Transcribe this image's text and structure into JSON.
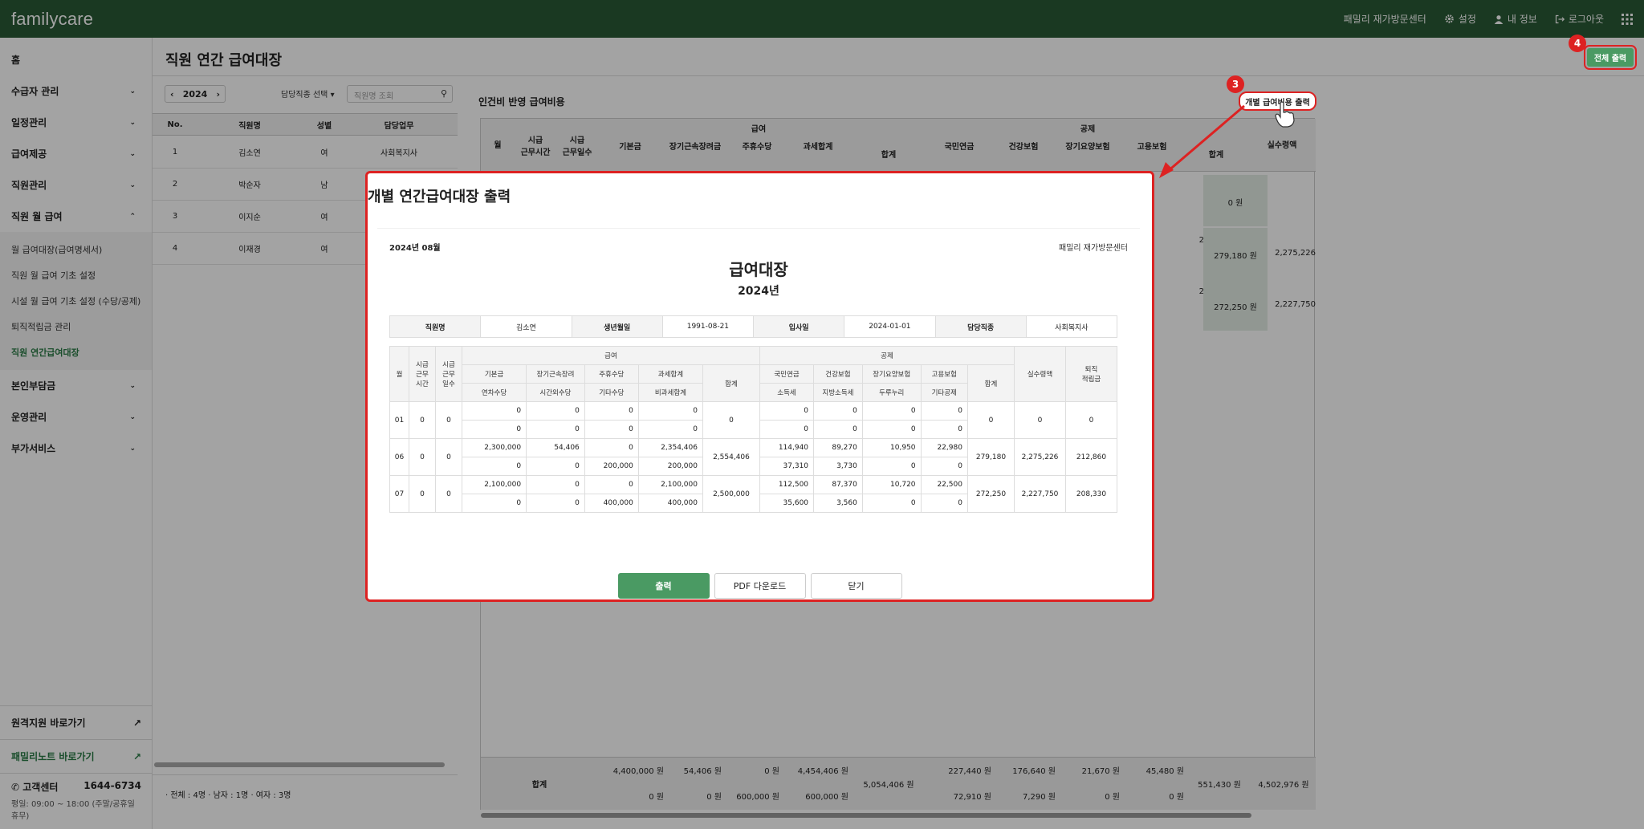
{
  "app": {
    "logo": "familycare"
  },
  "topbar": {
    "center_name": "패밀리 재가방문센터",
    "settings": "설정",
    "myinfo": "내 정보",
    "logout": "로그아웃"
  },
  "sidebar": {
    "home": "홈",
    "items": [
      "수급자 관리",
      "일정관리",
      "급여제공",
      "직원관리",
      "직원 월 급여"
    ],
    "subitems": [
      "월 급여대장(급여명세서)",
      "직원 월 급여 기초 설정",
      "시설 월 급여 기초 설정 (수당/공제)",
      "퇴직적립금 관리",
      "직원 연간급여대장"
    ],
    "items2": [
      "본인부담금",
      "운영관리",
      "부가서비스"
    ],
    "remote": "원격지원 바로가기",
    "note": "패밀리노트 바로가기",
    "cs_label": "고객센터",
    "cs_phone": "1644-6734",
    "cs_hours": "평일: 09:00 ~ 18:00 (주말/공휴일 휴무)"
  },
  "page": {
    "title": "직원 연간 급여대장",
    "print_all": "전체 출력"
  },
  "left": {
    "year": "2024",
    "role_select": "담당직종 선택",
    "search_placeholder": "직원명 조회",
    "headers": [
      "No.",
      "직원명",
      "성별",
      "담당업무"
    ],
    "rows": [
      [
        "1",
        "김소연",
        "여",
        "사회복지사"
      ],
      [
        "2",
        "박순자",
        "남",
        ""
      ],
      [
        "3",
        "이지순",
        "여",
        ""
      ],
      [
        "4",
        "이재경",
        "여",
        ""
      ]
    ],
    "count": "· 전체 : 4명  · 남자 : 1명  · 여자 : 3명"
  },
  "right": {
    "title": "인건비 반영 급여비용",
    "indiv_print": "개별 급여비용 출력",
    "head": {
      "month": "월",
      "hours": "시급\n근무시간",
      "days": "시급\n근무일수",
      "pay": "급여",
      "deduct": "공제",
      "basic": "기본금",
      "long": "장기근속장려금",
      "weekly": "주휴수당",
      "taxsum": "과세합계",
      "annual": "연차수당",
      "overtime": "시간외수당",
      "other": "기타수당",
      "nontax": "비과세합계",
      "sum": "합계",
      "pension": "국민연금",
      "health": "건강보험",
      "ltc": "장기요양보험",
      "employ": "고용보험",
      "income": "소득세",
      "local": "지방소득세",
      "duru": "두루누리",
      "otherded": "기타공제",
      "net": "실수령액"
    },
    "rows": [
      {
        "a": "0 원",
        "b": "0 원",
        "tot": "0 원"
      },
      {
        "a": "22,980 원",
        "b": "0 원",
        "tot": "279,180 원",
        "net": "2,275,226"
      },
      {
        "a": "22,500 원",
        "b": "0 원",
        "tot": "272,250 원",
        "net": "2,227,750"
      }
    ],
    "total": {
      "label": "합계",
      "r1": [
        "4,400,000 원",
        "54,406 원",
        "0 원",
        "4,454,406 원"
      ],
      "r2": [
        "0 원",
        "0 원",
        "600,000 원",
        "600,000 원"
      ],
      "paysum": "5,054,406 원",
      "d1": [
        "227,440 원",
        "176,640 원",
        "21,670 원",
        "45,480 원"
      ],
      "d2": [
        "",
        "72,910 원",
        "7,290 원",
        "0 원",
        "0 원"
      ],
      "dsum": "551,430 원",
      "net": "4,502,976 원"
    }
  },
  "modal": {
    "title": "개별 연간급여대장 출력",
    "date": "2024년 08월",
    "org": "패밀리 재가방문센터",
    "h1": "급여대장",
    "h2": "2024년",
    "info": {
      "l1": "직원명",
      "v1": "김소연",
      "l2": "생년월일",
      "v2": "1991-08-21",
      "l3": "입사일",
      "v3": "2024-01-01",
      "l4": "담당직종",
      "v4": "사회복지사"
    },
    "th": {
      "month": "월",
      "hours": "시급\n근무\n시간",
      "days": "시급\n근무\n일수",
      "pay": "급여",
      "deduct": "공제",
      "basic": "기본금",
      "long": "장기근속장려",
      "weekly": "주휴수당",
      "taxsum": "과세합계",
      "sum": "합계",
      "pension": "국민연금",
      "health": "건강보험",
      "ltc": "장기요양보험",
      "employ": "고용보험",
      "dsum": "합계",
      "net": "실수령액",
      "retire": "퇴직\n적립금",
      "annual": "연차수당",
      "overtime": "시간외수당",
      "other": "기타수당",
      "nontax": "비과세합계",
      "income": "소득세",
      "local": "지방소득세",
      "duru": "두루누리",
      "otherded": "기타공제"
    },
    "rows": [
      {
        "m": "01",
        "h": "0",
        "d": "0",
        "a": [
          "0",
          "0",
          "0",
          "0"
        ],
        "b": [
          "0",
          "0",
          "0",
          "0"
        ],
        "sum": "0",
        "c": [
          "0",
          "0",
          "0",
          "0"
        ],
        "e": [
          "0",
          "0",
          "0",
          "0"
        ],
        "dsum": "0",
        "net": "0",
        "ret": "0"
      },
      {
        "m": "06",
        "h": "0",
        "d": "0",
        "a": [
          "2,300,000",
          "54,406",
          "0",
          "2,354,406"
        ],
        "b": [
          "0",
          "0",
          "200,000",
          "200,000"
        ],
        "sum": "2,554,406",
        "c": [
          "114,940",
          "89,270",
          "10,950",
          "22,980"
        ],
        "e": [
          "37,310",
          "3,730",
          "0",
          "0"
        ],
        "dsum": "279,180",
        "net": "2,275,226",
        "ret": "212,860"
      },
      {
        "m": "07",
        "h": "0",
        "d": "0",
        "a": [
          "2,100,000",
          "0",
          "0",
          "2,100,000"
        ],
        "b": [
          "0",
          "0",
          "400,000",
          "400,000"
        ],
        "sum": "2,500,000",
        "c": [
          "112,500",
          "87,370",
          "10,720",
          "22,500"
        ],
        "e": [
          "35,600",
          "3,560",
          "0",
          "0"
        ],
        "dsum": "272,250",
        "net": "2,227,750",
        "ret": "208,330"
      }
    ],
    "btn_print": "출력",
    "btn_pdf": "PDF 다운로드",
    "btn_close": "닫기"
  },
  "annotations": {
    "step3": "3",
    "step4": "4"
  },
  "colors": {
    "topbar": "#2a5a36",
    "accent": "#4a9a63",
    "highlight": "#dd2222"
  }
}
